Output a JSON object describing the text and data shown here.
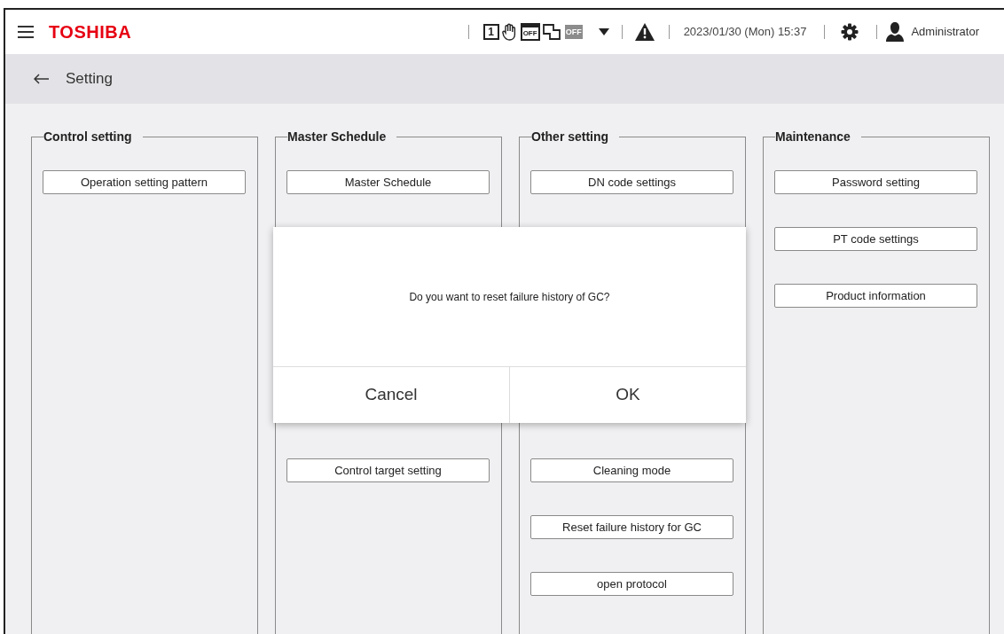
{
  "header": {
    "logo": "TOSHIBA",
    "status_icons": [
      {
        "kind": "number",
        "text": "1"
      },
      {
        "kind": "hand"
      },
      {
        "kind": "calendar",
        "text": "OFF"
      },
      {
        "kind": "switch"
      },
      {
        "kind": "badge",
        "text": "OFF"
      }
    ],
    "datetime": "2023/01/30 (Mon) 15:37",
    "user": "Administrator"
  },
  "page_title": "Setting",
  "columns": [
    {
      "sections": [
        {
          "title": "Control setting",
          "buttons": [
            "Operation setting pattern"
          ]
        }
      ]
    },
    {
      "sections": [
        {
          "title": "Master Schedule",
          "buttons": [
            "Master Schedule"
          ]
        },
        {
          "buttons": [
            "Control target setting"
          ]
        }
      ]
    },
    {
      "sections": [
        {
          "title": "Other setting",
          "buttons": [
            "DN code settings"
          ]
        },
        {
          "buttons": [
            "Cleaning mode",
            "Reset failure history for GC",
            "open protocol"
          ]
        }
      ]
    },
    {
      "sections": [
        {
          "title": "Maintenance",
          "buttons": [
            "Password setting",
            "PT code settings",
            "Product information"
          ]
        }
      ]
    }
  ],
  "dialog": {
    "message": "Do you want to reset failure history of GC?",
    "buttons": [
      "Cancel",
      "OK"
    ]
  }
}
